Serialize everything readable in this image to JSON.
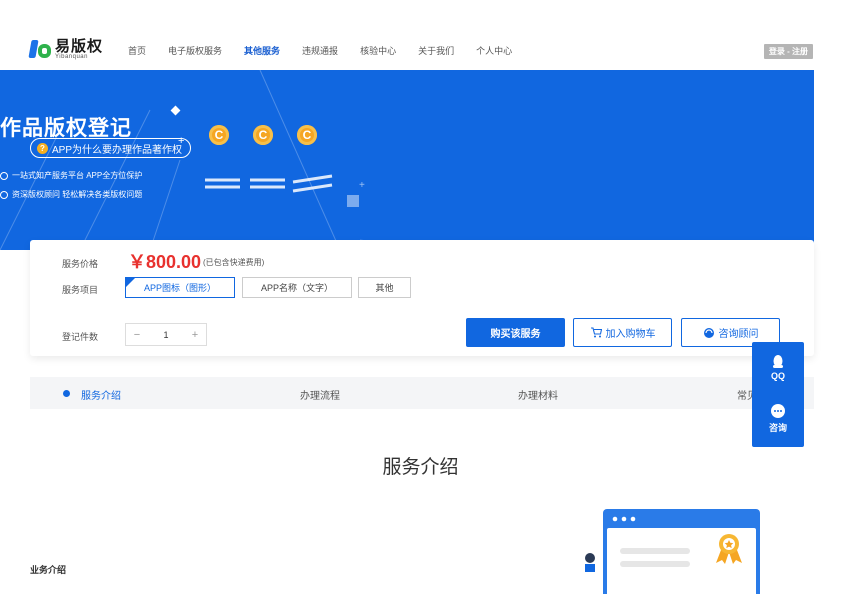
{
  "header": {
    "logo_cn": "易版权",
    "logo_en": "Yibanquan",
    "nav": [
      "首页",
      "电子版权服务",
      "其他服务",
      "违规通报",
      "核验中心",
      "关于我们",
      "个人中心"
    ],
    "active_nav": "其他服务",
    "login_label": "登录 - 注册"
  },
  "banner": {
    "title": "作品版权登记",
    "pill_icon": "?",
    "pill_text": "APP为什么要办理作品著作权",
    "lines": [
      "一站式知产服务平台 APP全方位保护",
      "资深版权顾问 轻松解决各类版权问题"
    ],
    "coin_symbol": "C",
    "bg_color": "#1167e0"
  },
  "order": {
    "price_label": "服务价格",
    "price": "￥800.00",
    "price_note": "(已包含快递费用)",
    "item_label": "服务项目",
    "options": [
      "APP图标（图形）",
      "APP名称（文字）",
      "其他"
    ],
    "selected_option": "APP图标（图形）",
    "count_label": "登记件数",
    "minus": "−",
    "count": "1",
    "plus": "+",
    "buy_label": "购买该服务",
    "cart_label": "加入购物车",
    "consult_label": "咨询顾问",
    "price_color": "#e8312e"
  },
  "tabs": {
    "items": [
      "服务介绍",
      "办理流程",
      "办理材料",
      "常见"
    ],
    "active": "服务介绍"
  },
  "float": {
    "qq_label": "QQ",
    "consult_label": "咨询"
  },
  "section": {
    "title": "服务介绍",
    "sub_label": "业务介绍"
  }
}
